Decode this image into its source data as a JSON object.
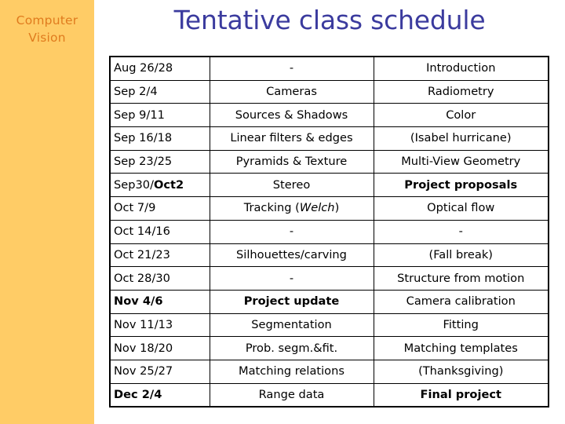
{
  "sidebar": {
    "label": "Computer\nVision",
    "bg_color": "#ffcc66",
    "text_color": "#e07b1e"
  },
  "title": {
    "text": "Tentative class schedule",
    "color": "#3b3b9e"
  },
  "table": {
    "columns": [
      "dates",
      "tuesday_topic",
      "thursday_topic"
    ],
    "rows": [
      {
        "date": "Aug 26/28",
        "date_bold_part": "",
        "tue": "-",
        "thu": "Introduction",
        "tue_bold": false,
        "thu_bold": false
      },
      {
        "date": "Sep 2/4",
        "date_bold_part": "",
        "tue": "Cameras",
        "thu": "Radiometry",
        "tue_bold": false,
        "thu_bold": false
      },
      {
        "date": "Sep 9/11",
        "date_bold_part": "",
        "tue": "Sources & Shadows",
        "thu": "Color",
        "tue_bold": false,
        "thu_bold": false
      },
      {
        "date": "Sep 16/18",
        "date_bold_part": "",
        "tue": "Linear filters & edges",
        "thu": "(Isabel hurricane)",
        "tue_bold": false,
        "thu_bold": false
      },
      {
        "date": "Sep 23/25",
        "date_bold_part": "",
        "tue": "Pyramids & Texture",
        "thu": "Multi-View Geometry",
        "tue_bold": false,
        "thu_bold": false
      },
      {
        "date": "Sep30/",
        "date_bold_part": "Oct2",
        "tue": "Stereo",
        "thu": "Project proposals",
        "tue_bold": false,
        "thu_bold": true
      },
      {
        "date": "Oct 7/9",
        "date_bold_part": "",
        "tue": "Tracking (Welch)",
        "thu": "Optical flow",
        "tue_bold": false,
        "thu_bold": false,
        "tue_italic_part": "Welch"
      },
      {
        "date": "Oct 14/16",
        "date_bold_part": "",
        "tue": "-",
        "thu": "-",
        "tue_bold": false,
        "thu_bold": false
      },
      {
        "date": "Oct 21/23",
        "date_bold_part": "",
        "tue": "Silhouettes/carving",
        "thu": "(Fall break)",
        "tue_bold": false,
        "thu_bold": false
      },
      {
        "date": "Oct 28/30",
        "date_bold_part": "",
        "tue": "-",
        "thu": "Structure from motion",
        "tue_bold": false,
        "thu_bold": false
      },
      {
        "date": "Nov 4/6",
        "date_bold_part": "",
        "tue": "Project update",
        "thu": "Camera calibration",
        "tue_bold": true,
        "thu_bold": false,
        "date_bold": true
      },
      {
        "date": "Nov 11/13",
        "date_bold_part": "",
        "tue": "Segmentation",
        "thu": "Fitting",
        "tue_bold": false,
        "thu_bold": false
      },
      {
        "date": "Nov 18/20",
        "date_bold_part": "",
        "tue": "Prob. segm.&fit.",
        "thu": "Matching templates",
        "tue_bold": false,
        "thu_bold": false
      },
      {
        "date": "Nov 25/27",
        "date_bold_part": "",
        "tue": "Matching relations",
        "thu": "(Thanksgiving)",
        "tue_bold": false,
        "thu_bold": false
      },
      {
        "date": "Dec 2/4",
        "date_bold_part": "",
        "tue": "Range data",
        "thu": "Final project",
        "tue_bold": false,
        "thu_bold": true,
        "date_bold": true
      }
    ]
  }
}
